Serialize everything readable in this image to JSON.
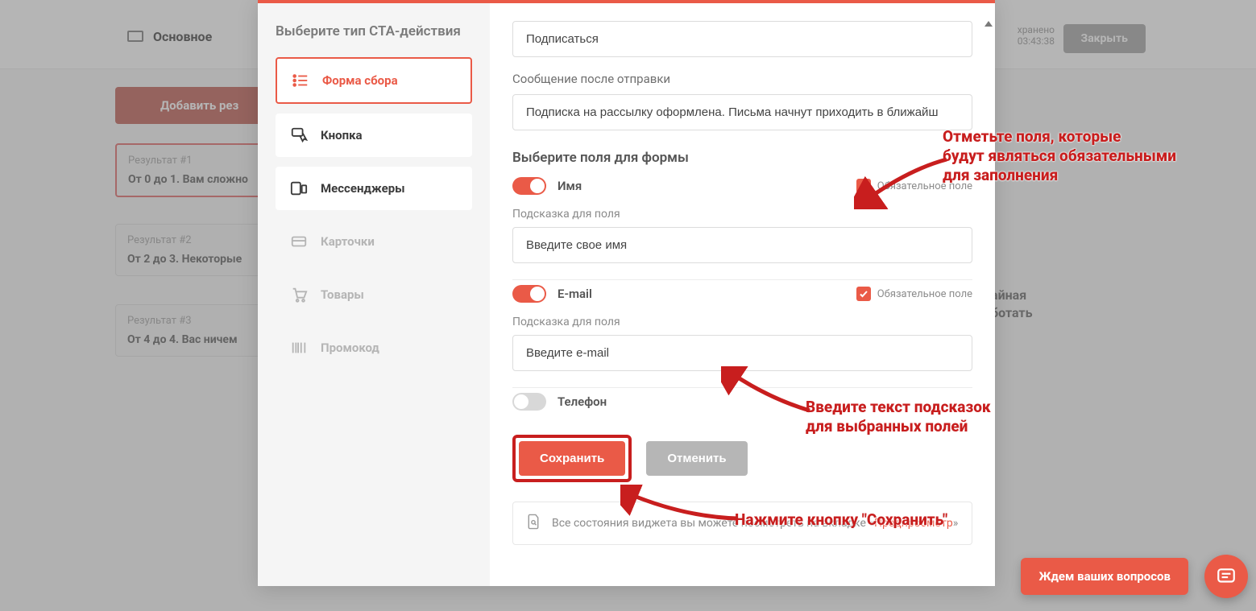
{
  "header": {
    "main_tab": "Основное",
    "saved_label": "хранено",
    "saved_time": "03:43:38",
    "close_btn": "Закрыть"
  },
  "sidebar": {
    "add_result": "Добавить рез",
    "results": [
      {
        "label": "Результат #1",
        "text": "От 0 до 1.  Вам сложно"
      },
      {
        "label": "Результат #2",
        "text": "От 2 до 3.  Некоторые"
      },
      {
        "label": "Результат #3",
        "text": "От 4 до 4.  Вас ничем"
      }
    ]
  },
  "right_bg": "айная\nботать",
  "modal": {
    "left_title": "Выберите тип CTA-действия",
    "cta": [
      {
        "key": "form",
        "label": "Форма сбора",
        "state": "selected"
      },
      {
        "key": "button",
        "label": "Кнопка",
        "state": "normal"
      },
      {
        "key": "messengers",
        "label": "Мессенджеры",
        "state": "normal"
      },
      {
        "key": "cards",
        "label": "Карточки",
        "state": "disabled"
      },
      {
        "key": "products",
        "label": "Товары",
        "state": "disabled"
      },
      {
        "key": "promo",
        "label": "Промокод",
        "state": "disabled"
      }
    ],
    "right": {
      "subscribe_input": "Подписаться",
      "after_send_label": "Сообщение после отправки",
      "after_send_value": "Подписка на рассылку оформлена. Письма начнут приходить в ближайш",
      "fields_title": "Выберите поля для формы",
      "req_label": "Обязательное поле",
      "hint_label": "Подсказка для поля",
      "fields": {
        "name": {
          "title": "Имя",
          "on": true,
          "required": true,
          "hint": "Введите свое имя"
        },
        "email": {
          "title": "E-mail",
          "on": true,
          "required": true,
          "hint": "Введите e-mail"
        },
        "phone": {
          "title": "Телефон",
          "on": false,
          "required": false
        }
      },
      "save_btn": "Сохранить",
      "cancel_btn": "Отменить",
      "preview_hint_prefix": "Все состояния виджета вы можете посмотреть на вкладке «",
      "preview_hint_link": "Предпросмотр",
      "preview_hint_suffix": "»"
    }
  },
  "annotations": {
    "a1": "Отметьте поля, которые\nбудут являться обязательными\nдля заполнения",
    "a2": "Введите текст подсказок\nдля выбранных полей",
    "a3": "Нажмите кнопку \"Сохранить\""
  },
  "chat": {
    "cta": "Ждем ваших вопросов"
  }
}
